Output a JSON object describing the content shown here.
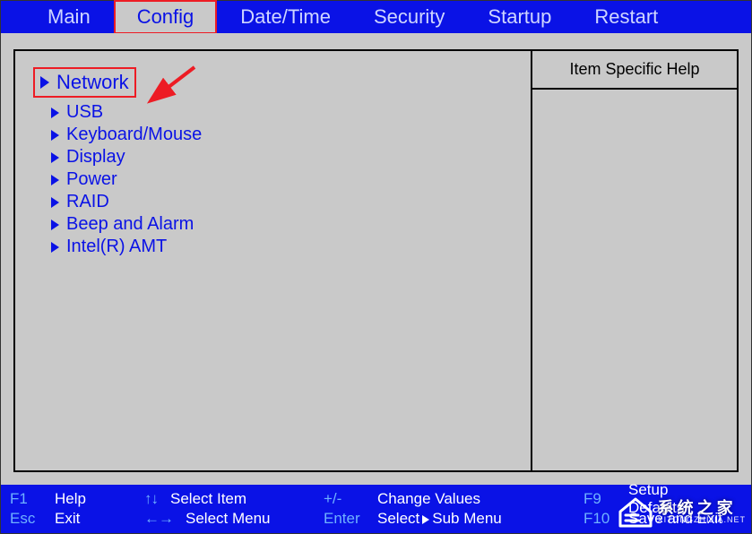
{
  "tabs": {
    "main": "Main",
    "config": "Config",
    "datetime": "Date/Time",
    "security": "Security",
    "startup": "Startup",
    "restart": "Restart",
    "active": "config"
  },
  "help_panel": {
    "title": "Item Specific Help"
  },
  "menu": {
    "network": "Network",
    "usb": "USB",
    "keyboard_mouse": "Keyboard/Mouse",
    "display": "Display",
    "power": "Power",
    "raid": "RAID",
    "beep_alarm": "Beep and Alarm",
    "intel_amt": "Intel(R) AMT"
  },
  "footer": {
    "f1": {
      "key": "F1",
      "label": "Help"
    },
    "esc": {
      "key": "Esc",
      "label": "Exit"
    },
    "select_item": "Select Item",
    "select_menu": "Select Menu",
    "pm": {
      "key": "+/-",
      "label": "Change Values"
    },
    "enter": {
      "key": "Enter",
      "label_pre": "Select",
      "label_post": "Sub Menu"
    },
    "f9": {
      "key": "F9",
      "label": "Setup Defaults"
    },
    "f10": {
      "key": "F10",
      "label": "Save and Exit"
    }
  },
  "watermark": {
    "cn": "系统之家",
    "url": "XITONGZHIJIA.NET"
  }
}
